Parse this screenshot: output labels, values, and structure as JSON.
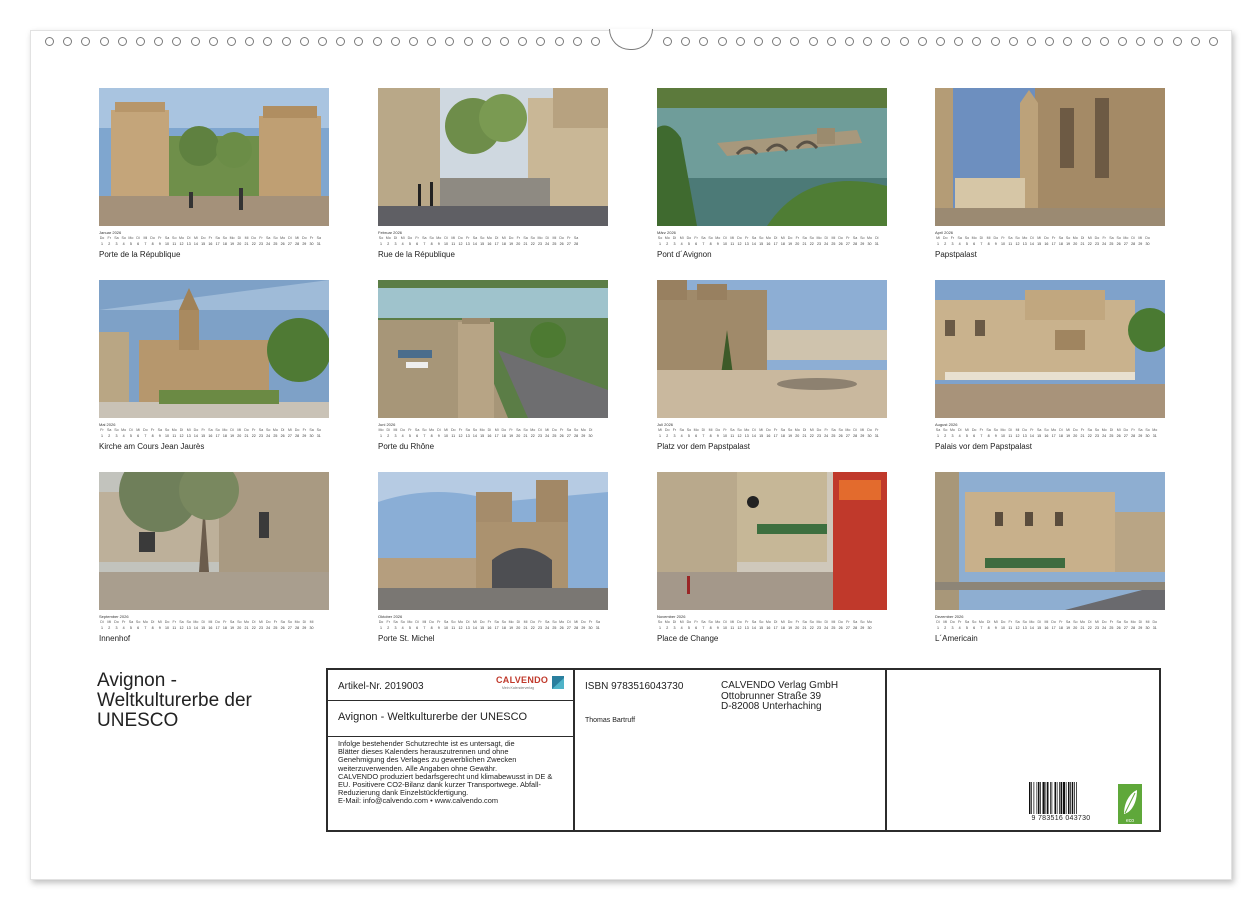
{
  "product": {
    "title_lines": [
      "Avignon -",
      "Weltkulturerbe der",
      "UNESCO"
    ]
  },
  "months": [
    {
      "name": "Januar 2026",
      "caption": "Porte de la République",
      "photo": "city-gate-towers-photo",
      "first_dow": 3,
      "days": 31
    },
    {
      "name": "Februar 2026",
      "caption": "Rue de la République",
      "photo": "street-with-trees-photo",
      "first_dow": 6,
      "days": 28
    },
    {
      "name": "März 2026",
      "caption": "Pont d´Avignon",
      "photo": "bridge-over-river-photo",
      "first_dow": 6,
      "days": 31
    },
    {
      "name": "April 2026",
      "caption": "Papstpalast",
      "photo": "papal-palace-photo",
      "first_dow": 2,
      "days": 30
    },
    {
      "name": "Mai 2026",
      "caption": "Kirche am Cours Jean Jaurès",
      "photo": "church-photo",
      "first_dow": 4,
      "days": 31
    },
    {
      "name": "Juni 2026",
      "caption": "Porte du Rhône",
      "photo": "aerial-gate-river-photo",
      "first_dow": 0,
      "days": 30
    },
    {
      "name": "Juli 2026",
      "caption": "Platz vor dem Papstpalast",
      "photo": "palace-square-photo",
      "first_dow": 2,
      "days": 31
    },
    {
      "name": "August 2026",
      "caption": "Palais vor dem Papstpalast",
      "photo": "ornate-palace-facade-photo",
      "first_dow": 5,
      "days": 31
    },
    {
      "name": "September 2026",
      "caption": "Innenhof",
      "photo": "courtyard-trees-photo",
      "first_dow": 1,
      "days": 30
    },
    {
      "name": "Oktober 2026",
      "caption": "Porte St. Michel",
      "photo": "stone-gate-photo",
      "first_dow": 3,
      "days": 31
    },
    {
      "name": "November 2026",
      "caption": "Place de Change",
      "photo": "cafe-square-photo",
      "first_dow": 6,
      "days": 30
    },
    {
      "name": "Dezember 2026",
      "caption": "L´Americain",
      "photo": "street-hotel-photo",
      "first_dow": 1,
      "days": 31
    }
  ],
  "weekday_abbr": [
    "Mo",
    "Di",
    "Mi",
    "Do",
    "Fr",
    "Sa",
    "So"
  ],
  "infobox": {
    "artikel": "Artikel-Nr. 2019003",
    "logo": "CALVENDO",
    "logo_sub": "Mein Kalenderverlag",
    "title": "Avignon - Weltkulturerbe der UNESCO",
    "legal_lines": [
      "Infolge bestehender Schutzrechte ist es untersagt, die",
      "Blätter dieses Kalenders herauszutrennen und ohne",
      "Genehmigung des Verlages zu gewerblichen Zwecken",
      "weiterzuverwenden. Alle Angaben ohne Gewähr.",
      "CALVENDO produziert bedarfsgerecht und klimabewusst in DE &",
      "EU. Positivere CO2-Bilanz dank kurzer Transportwege. Abfall-",
      "Reduzierung dank Einzelstückfertigung.",
      "E-Mail: info@calvendo.com • www.calvendo.com"
    ],
    "isbn": "ISBN 9783516043730",
    "author": "Thomas Bartruff",
    "publisher_lines": [
      "CALVENDO Verlag GmbH",
      "Ottobrunner Straße 39",
      "D-82008 Unterhaching"
    ],
    "barcode_number": "9 783516 043730",
    "eco_label": "eco"
  },
  "colors": {
    "sky": "#8fb4d9",
    "stone": "#b79a72",
    "brand_red": "#c0392b",
    "eco_green": "#5fa83a"
  }
}
